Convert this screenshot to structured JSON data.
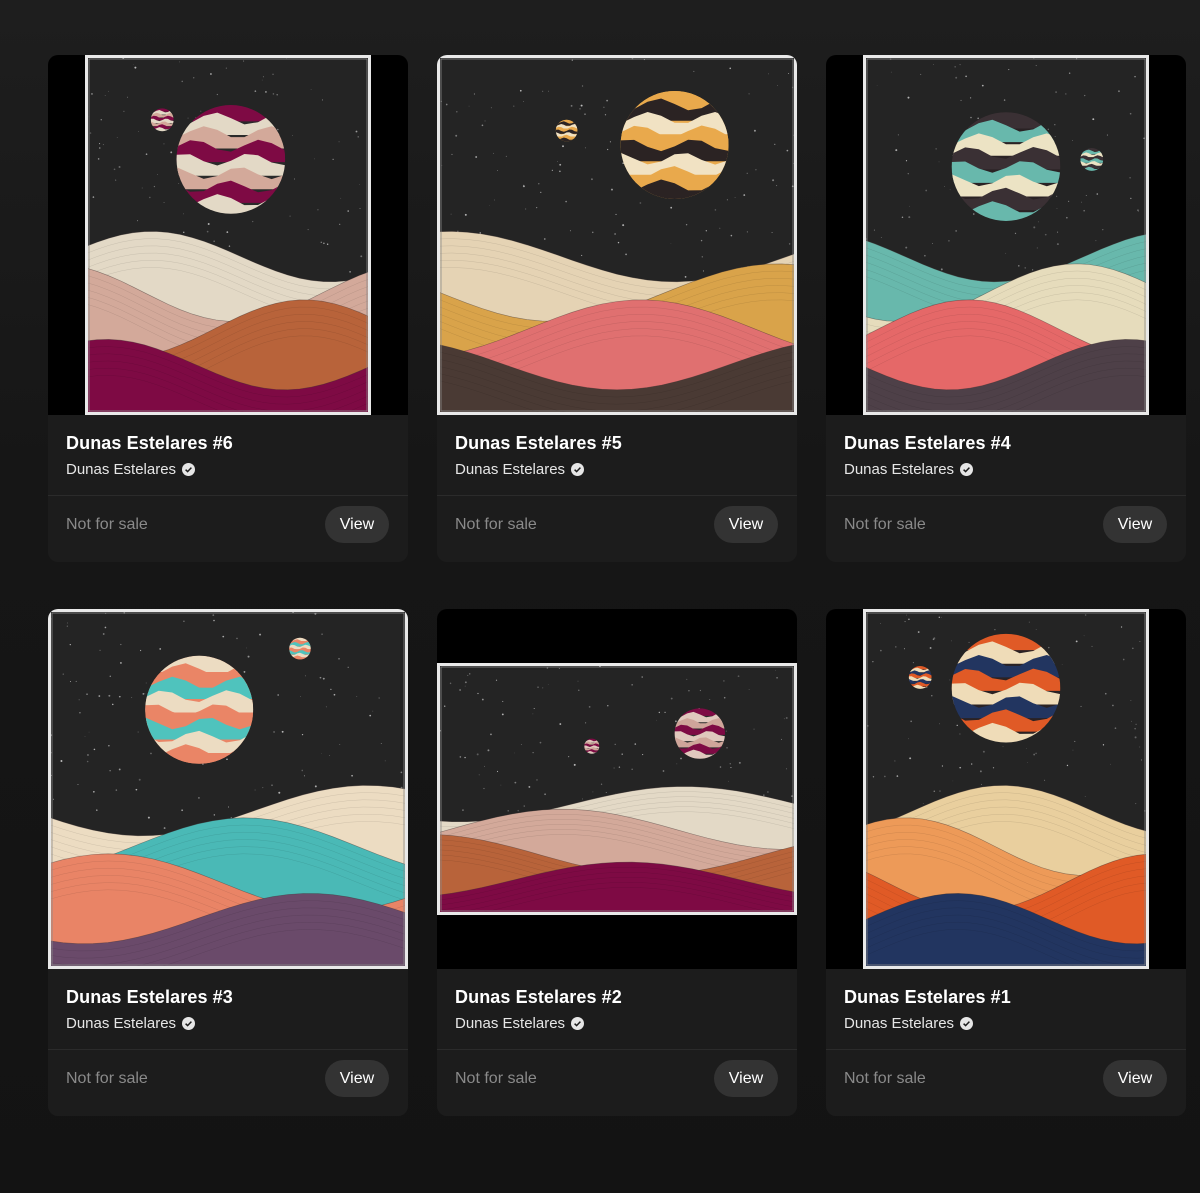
{
  "cards": [
    {
      "title": "Dunas Estelares #6",
      "collection": "Dunas Estelares",
      "price": "Not for sale",
      "view_label": "View",
      "palette": [
        "#e3d9c6",
        "#d3a99a",
        "#b8633a",
        "#7e0a44"
      ],
      "planet_colors": [
        "#7e0a44",
        "#e3d9c6",
        "#d3a99a",
        "#2a2a2a"
      ]
    },
    {
      "title": "Dunas Estelares #5",
      "collection": "Dunas Estelares",
      "price": "Not for sale",
      "view_label": "View",
      "palette": [
        "#e5d3b4",
        "#d9a34a",
        "#e07070",
        "#4a3a34"
      ],
      "planet_colors": [
        "#e9a94c",
        "#2b2323",
        "#f1e2c3",
        "#e9a94c"
      ]
    },
    {
      "title": "Dunas Estelares #4",
      "collection": "Dunas Estelares",
      "price": "Not for sale",
      "view_label": "View",
      "palette": [
        "#68b8ac",
        "#e6dcbc",
        "#e56868",
        "#4e4048"
      ],
      "planet_colors": [
        "#3a3034",
        "#68b8ac",
        "#ece3c4",
        "#2a2224"
      ]
    },
    {
      "title": "Dunas Estelares #3",
      "collection": "Dunas Estelares",
      "price": "Not for sale",
      "view_label": "View",
      "palette": [
        "#ecdcc2",
        "#4ab9b6",
        "#e98466",
        "#6a4a6a"
      ],
      "planet_colors": [
        "#ecdcc2",
        "#ea8566",
        "#4fc3bd",
        "#ea8566"
      ]
    },
    {
      "title": "Dunas Estelares #2",
      "collection": "Dunas Estelares",
      "price": "Not for sale",
      "view_label": "View",
      "palette": [
        "#e3d9c6",
        "#d3a99a",
        "#b8633a",
        "#7e0a44"
      ],
      "planet_colors": [
        "#7e0a44",
        "#e0c8bd",
        "#cfa59a",
        "#2a2a2a"
      ]
    },
    {
      "title": "Dunas Estelares #1",
      "collection": "Dunas Estelares",
      "price": "Not for sale",
      "view_label": "View",
      "palette": [
        "#e9cf9e",
        "#ed9a58",
        "#e05a26",
        "#223560"
      ],
      "planet_colors": [
        "#e05a26",
        "#efdcb8",
        "#223560",
        "#2a2224"
      ]
    }
  ],
  "icons": {
    "verified": "verified-check-icon"
  },
  "colors": {
    "background": "#151515",
    "card": "#1c1c1c",
    "button": "#333333",
    "muted_text": "#8a8a8a"
  }
}
